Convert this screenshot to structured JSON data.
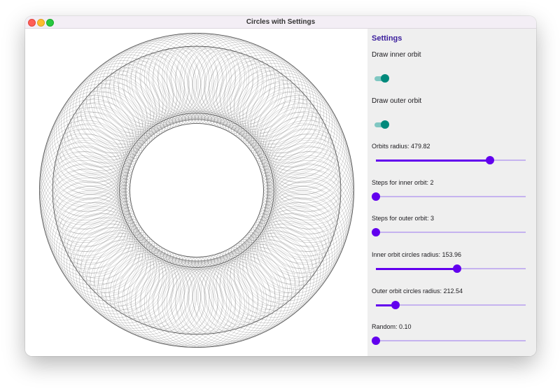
{
  "window": {
    "title": "Circles with Settings"
  },
  "canvas": {
    "inner_ring_outer_r": 0.236,
    "inner_ring_inner_r": 0.204,
    "outer_ring_outer_r": 0.48,
    "outer_ring_inner_r": 0.44
  },
  "settings": {
    "heading": "Settings",
    "toggles": [
      {
        "label": "Draw inner orbit",
        "on": true
      },
      {
        "label": "Draw outer orbit",
        "on": true
      }
    ],
    "sliders": [
      {
        "label": "Orbits radius: 479.82",
        "fraction": 0.76
      },
      {
        "label": "Steps for inner orbit: 2",
        "fraction": 0.0
      },
      {
        "label": "Steps for outer orbit: 3",
        "fraction": 0.0
      },
      {
        "label": "Inner orbit circles radius: 153.96",
        "fraction": 0.54
      },
      {
        "label": "Outer orbit circles radius: 212.54",
        "fraction": 0.13
      },
      {
        "label": "Random: 0.10",
        "fraction": 0.0
      }
    ]
  },
  "colors": {
    "accent": "#6200ee",
    "track_inactive": "#c5b3ef",
    "switch_thumb": "#00897b",
    "switch_track": "#80c7c2",
    "heading": "#3a1d9c"
  }
}
